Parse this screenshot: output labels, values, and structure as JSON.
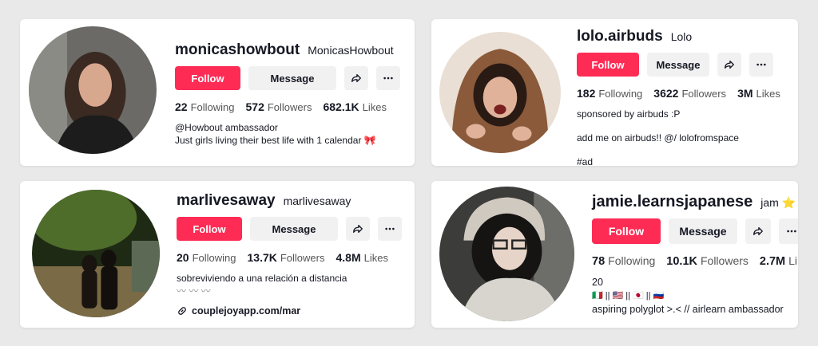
{
  "profiles": [
    {
      "username": "monicashowbout",
      "nickname": "MonicasHowbout",
      "follow_label": "Follow",
      "message_label": "Message",
      "following_count": "22",
      "following_label": "Following",
      "followers_count": "572",
      "followers_label": "Followers",
      "likes_count": "682.1K",
      "likes_label": "Likes",
      "bio": [
        "@Howbout ambassador",
        "Just girls living their best life with 1 calendar 🎀"
      ]
    },
    {
      "username": "lolo.airbuds",
      "nickname": "Lolo",
      "follow_label": "Follow",
      "message_label": "Message",
      "following_count": "182",
      "following_label": "Following",
      "followers_count": "3622",
      "followers_label": "Followers",
      "likes_count": "3M",
      "likes_label": "Likes",
      "bio": [
        "sponsored by airbuds :P",
        "add me on airbuds!! @/ lolofromspace",
        "#ad"
      ]
    },
    {
      "username": "marlivesaway",
      "nickname": "marlivesaway",
      "follow_label": "Follow",
      "message_label": "Message",
      "following_count": "20",
      "following_label": "Following",
      "followers_count": "13.7K",
      "followers_label": "Followers",
      "likes_count": "4.8M",
      "likes_label": "Likes",
      "bio": [
        "sobreviviendo a una relación a distancia",
        "〰 〰 〰"
      ],
      "link": "couplejoyapp.com/mar"
    },
    {
      "username": "jamie.learnsjapanese",
      "nickname": "jam ⭐",
      "follow_label": "Follow",
      "message_label": "Message",
      "following_count": "78",
      "following_label": "Following",
      "followers_count": "10.1K",
      "followers_label": "Followers",
      "likes_count": "2.7M",
      "likes_label": "Li",
      "bio": [
        "20",
        "🇮🇹 || 🇺🇸 || 🇯🇵 || 🇷🇺",
        "aspiring polyglot >.< // airlearn ambassador"
      ]
    }
  ],
  "icons": {
    "share": "share-arrow-icon",
    "more": "more-dots-icon",
    "link": "link-icon"
  },
  "colors": {
    "follow": "#fe2c55",
    "secondary_button": "#f1f1f2",
    "page_background": "#e9e9e9"
  }
}
